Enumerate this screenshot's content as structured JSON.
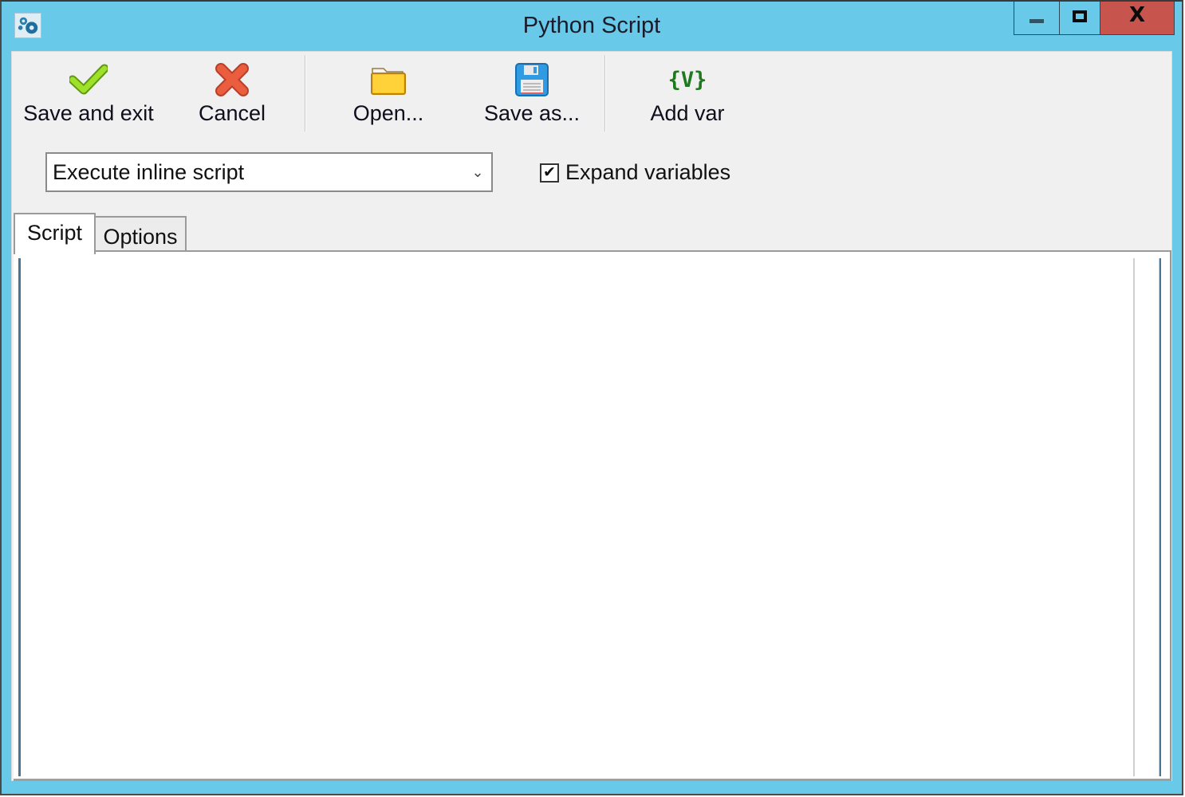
{
  "window": {
    "title": "Python Script",
    "app_icon": "gears-icon",
    "controls": {
      "minimize": "minimize",
      "maximize": "maximize",
      "close": "X"
    }
  },
  "toolbar": {
    "buttons": [
      {
        "label": "Save and exit",
        "icon": "checkmark-icon",
        "color": "#8cd01e"
      },
      {
        "label": "Cancel",
        "icon": "red-x-icon",
        "color": "#e0533a"
      },
      {
        "label": "Open...",
        "icon": "folder-icon",
        "color": "#f7c418"
      },
      {
        "label": "Save as...",
        "icon": "floppy-disk-icon",
        "color": "#2f9be2"
      },
      {
        "label": "Add var",
        "icon": "variable-icon",
        "glyph": "{V}",
        "color": "#1f7a1f"
      }
    ]
  },
  "mode_select": {
    "value": "Execute inline script",
    "arrow": "⌄"
  },
  "expand_variables": {
    "label": "Expand variables",
    "checked": true,
    "check_glyph": "✔"
  },
  "tabs": [
    {
      "label": "Script",
      "active": true
    },
    {
      "label": "Options",
      "active": false
    }
  ],
  "editor": {
    "content": ""
  }
}
